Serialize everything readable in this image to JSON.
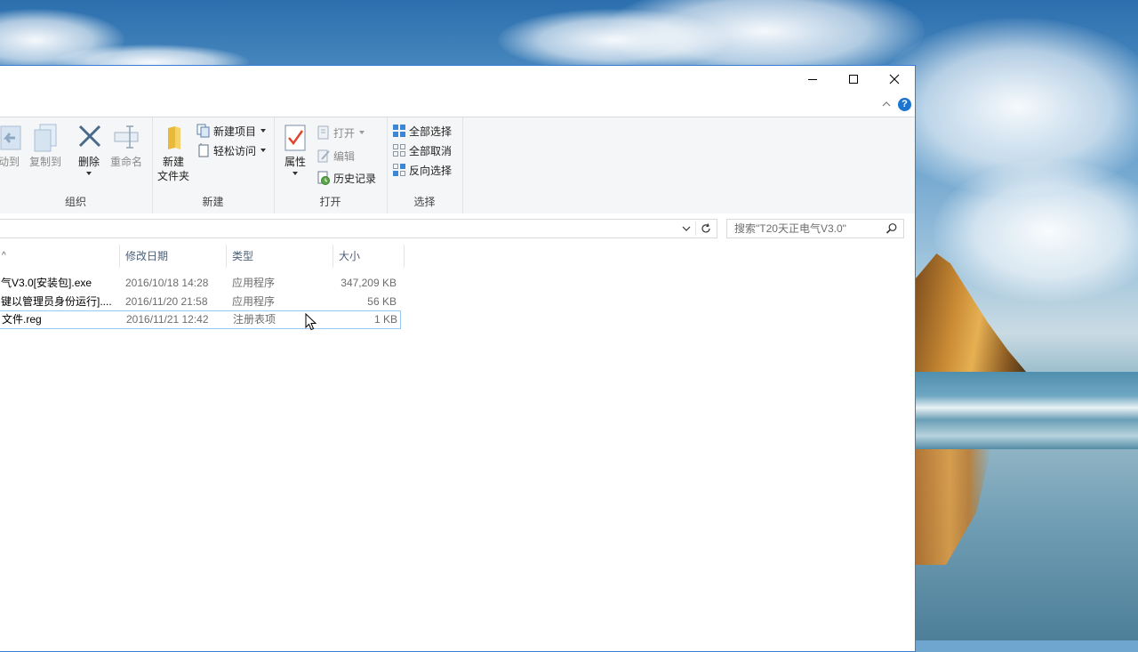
{
  "ribbon": {
    "organize": {
      "label": "组织",
      "move_to": "移动到",
      "copy_to": "复制到",
      "delete": "删除",
      "rename": "重命名"
    },
    "new": {
      "label": "新建",
      "new_folder_line1": "新建",
      "new_folder_line2": "文件夹",
      "new_item": "新建项目",
      "easy_access": "轻松访问"
    },
    "open": {
      "label": "打开",
      "properties": "属性",
      "open": "打开",
      "edit": "编辑",
      "history": "历史记录"
    },
    "select": {
      "label": "选择",
      "select_all": "全部选择",
      "select_none": "全部取消",
      "invert": "反向选择"
    }
  },
  "search": {
    "placeholder": "搜索\"T20天正电气V3.0\""
  },
  "columns": {
    "date": "修改日期",
    "type": "类型",
    "size": "大小"
  },
  "files": [
    {
      "name": "气V3.0[安装包].exe",
      "date": "2016/10/18 14:28",
      "type": "应用程序",
      "size": "347,209 KB"
    },
    {
      "name": "键以管理员身份运行]....",
      "date": "2016/11/20 21:58",
      "type": "应用程序",
      "size": "56 KB"
    },
    {
      "name": "文件.reg",
      "date": "2016/11/21 12:42",
      "type": "注册表项",
      "size": "1 KB"
    }
  ],
  "colors": {
    "accent": "#3a7bd5",
    "help": "#1c75d0",
    "header_text": "#4c607a",
    "row_focus": "#99c8f0"
  }
}
